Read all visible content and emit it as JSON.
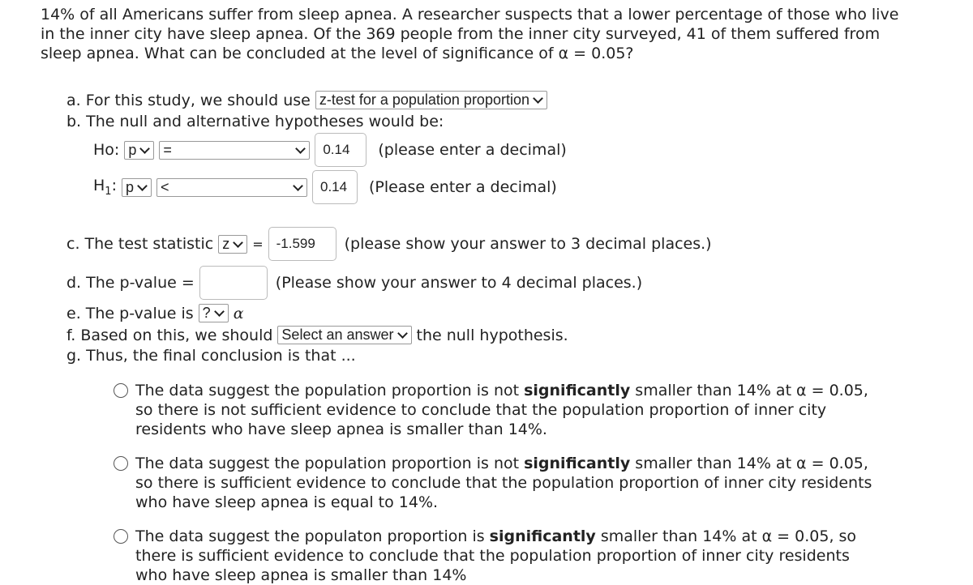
{
  "question": "14% of all Americans suffer from sleep apnea. A researcher suspects that a lower percentage of those who live in the inner city have sleep apnea. Of the 369 people from the inner city surveyed, 41 of them suffered from sleep apnea. What can be concluded at the level of significance of α = 0.05?",
  "a": {
    "label": "a. For this study, we should use",
    "select": "z-test for a population proportion"
  },
  "b": {
    "label": "b. The null and alternative hypotheses would be:"
  },
  "h0": {
    "label": "Ho:",
    "param": "p",
    "op": "=",
    "value": "0.14",
    "hint": "(please enter a decimal)"
  },
  "h1": {
    "label": "H",
    "sub": "1",
    "colon": ":",
    "param": "p",
    "op": "<",
    "value": "0.14",
    "hint": "(Please enter a decimal)"
  },
  "c": {
    "label": "c. The test statistic",
    "select": "z",
    "eq": "=",
    "value": "-1.599",
    "hint": "(please show your answer to 3 decimal places.)"
  },
  "d": {
    "label": "d. The p-value =",
    "value": "",
    "hint": "(Please show your answer to 4 decimal places.)"
  },
  "e": {
    "label": "e. The p-value is",
    "select": "?",
    "alpha": "α"
  },
  "f": {
    "label": "f. Based on this, we should",
    "select": "Select an answer",
    "after": "the null hypothesis."
  },
  "g": {
    "label": "g. Thus, the final conclusion is that ..."
  },
  "options": [
    {
      "pre": "The data suggest the population proportion is not ",
      "bold": "significantly",
      "post": " smaller than 14% at α = 0.05, so there is not sufficient evidence to conclude that the population proportion of inner city residents who have sleep apnea is smaller than 14%."
    },
    {
      "pre": "The data suggest the population proportion is not ",
      "bold": "significantly",
      "post": " smaller than 14% at α = 0.05, so there is sufficient evidence to conclude that the population proportion of inner city residents who have sleep apnea is equal to 14%."
    },
    {
      "pre": "The data suggest the populaton proportion is ",
      "bold": "significantly",
      "post": " smaller than 14% at α = 0.05, so there is sufficient evidence to conclude that the population proportion of inner city residents who have sleep apnea is smaller than 14%"
    }
  ]
}
